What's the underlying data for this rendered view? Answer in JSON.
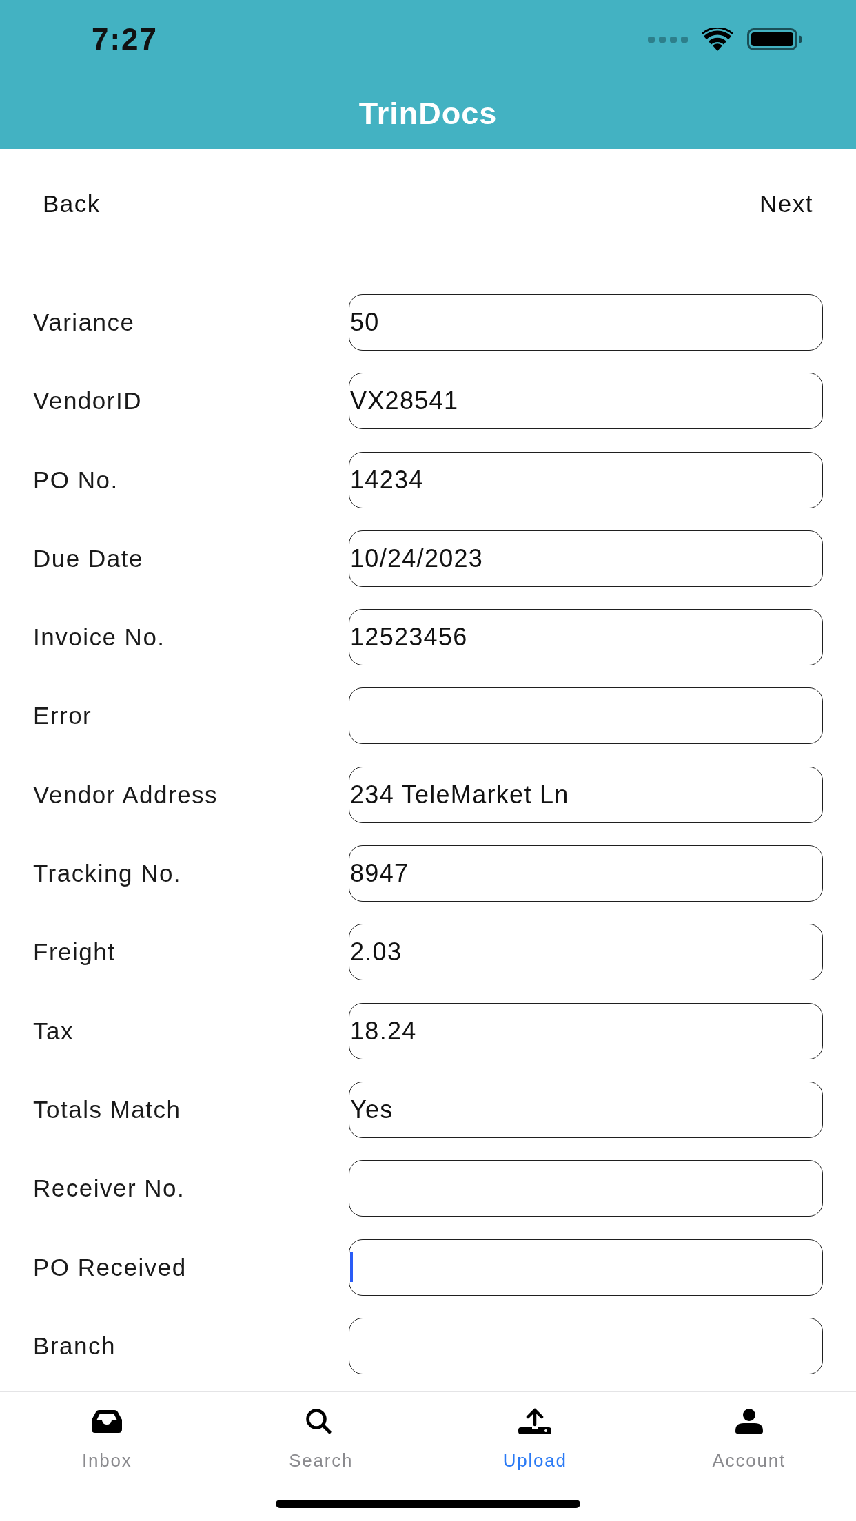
{
  "status_bar": {
    "time": "7:27"
  },
  "header": {
    "title": "TrinDocs"
  },
  "nav": {
    "back": "Back",
    "next": "Next"
  },
  "fields": [
    {
      "label": "Variance",
      "value": "50",
      "focused": false
    },
    {
      "label": "VendorID",
      "value": "VX28541",
      "focused": false
    },
    {
      "label": "PO No.",
      "value": "14234",
      "focused": false
    },
    {
      "label": "Due Date",
      "value": "10/24/2023",
      "focused": false
    },
    {
      "label": "Invoice No.",
      "value": "12523456",
      "focused": false
    },
    {
      "label": "Error",
      "focused": false
    },
    {
      "label": "Vendor Address",
      "value": "234 TeleMarket Ln",
      "focused": false
    },
    {
      "label": "Tracking No.",
      "value": "8947",
      "focused": false
    },
    {
      "label": "Freight",
      "value": "2.03",
      "focused": false
    },
    {
      "label": "Tax",
      "value": "18.24",
      "focused": false
    },
    {
      "label": "Totals Match",
      "value": "Yes",
      "focused": false
    },
    {
      "label": "Receiver No.",
      "focused": false
    },
    {
      "label": "PO Received",
      "focused": true
    },
    {
      "label": "Branch",
      "focused": false
    }
  ],
  "tabs": [
    {
      "label": "Inbox",
      "selected": false
    },
    {
      "label": "Search",
      "selected": false
    },
    {
      "label": "Upload",
      "selected": true
    },
    {
      "label": "Account",
      "selected": false
    }
  ]
}
